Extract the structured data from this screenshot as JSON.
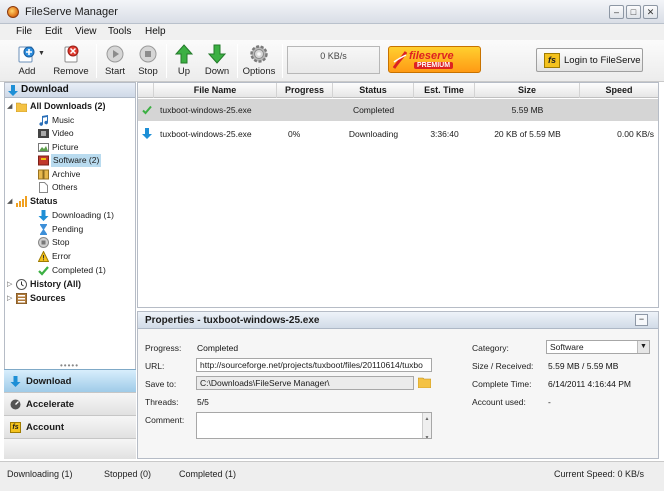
{
  "window": {
    "title": "FileServe Manager",
    "minimize": "–",
    "maximize": "□",
    "close": "✕"
  },
  "menu": [
    "File",
    "Edit",
    "View",
    "Tools",
    "Help"
  ],
  "toolbar": {
    "add": "Add",
    "remove": "Remove",
    "start": "Start",
    "stop": "Stop",
    "up": "Up",
    "down": "Down",
    "options": "Options",
    "speed": "0 KB/s",
    "banner_brand": "fileserve",
    "banner_tag": "PREMIUM",
    "login_icon": "fs",
    "login_label": "Login to FileServe"
  },
  "sidebar": {
    "header": "Download",
    "all_downloads": "All Downloads (2)",
    "categories": [
      "Music",
      "Video",
      "Picture",
      "Software (2)",
      "Archive",
      "Others"
    ],
    "status_header": "Status",
    "statuses": [
      "Downloading (1)",
      "Pending",
      "Stop",
      "Error",
      "Completed (1)"
    ],
    "history": "History (All)",
    "sources": "Sources",
    "grip": "•••••"
  },
  "nav": {
    "download": "Download",
    "accelerate": "Accelerate",
    "account_icon": "fs",
    "account": "Account"
  },
  "table": {
    "headers": [
      "File Name",
      "Progress",
      "Status",
      "Est. Time",
      "Size",
      "Speed"
    ],
    "rows": [
      {
        "name": "tuxboot-windows-25.exe",
        "progress": "",
        "status": "Completed",
        "time": "",
        "size": "5.59 MB",
        "speed": ""
      },
      {
        "name": "tuxboot-windows-25.exe",
        "progress": "0%",
        "status": "Downloading",
        "time": "3:36:40",
        "size": "20 KB of 5.59 MB",
        "speed": "0.00 KB/s"
      }
    ]
  },
  "properties": {
    "title": "Properties - tuxboot-windows-25.exe",
    "collapse": "−",
    "progress_label": "Progress:",
    "progress": "Completed",
    "url_label": "URL:",
    "url": "http://sourceforge.net/projects/tuxboot/files/20110614/tuxbo",
    "saveto_label": "Save to:",
    "saveto": "C:\\Downloads\\FileServe Manager\\",
    "threads_label": "Threads:",
    "threads": "5/5",
    "comment_label": "Comment:",
    "category_label": "Category:",
    "category": "Software",
    "size_label": "Size / Received:",
    "size": "5.59 MB / 5.59 MB",
    "ctime_label": "Complete Time:",
    "ctime": "6/14/2011 4:16:44 PM",
    "account_label": "Account used:",
    "account": "-"
  },
  "statusbar": {
    "downloading": "Downloading (1)",
    "stopped": "Stopped (0)",
    "completed": "Completed (1)",
    "speed": "Current Speed: 0 KB/s"
  },
  "colors": {
    "selection": "#b9dbef",
    "active_nav": "#9fcbe8",
    "accent_green": "#3cb043",
    "accent_blue": "#1e8fd6"
  }
}
